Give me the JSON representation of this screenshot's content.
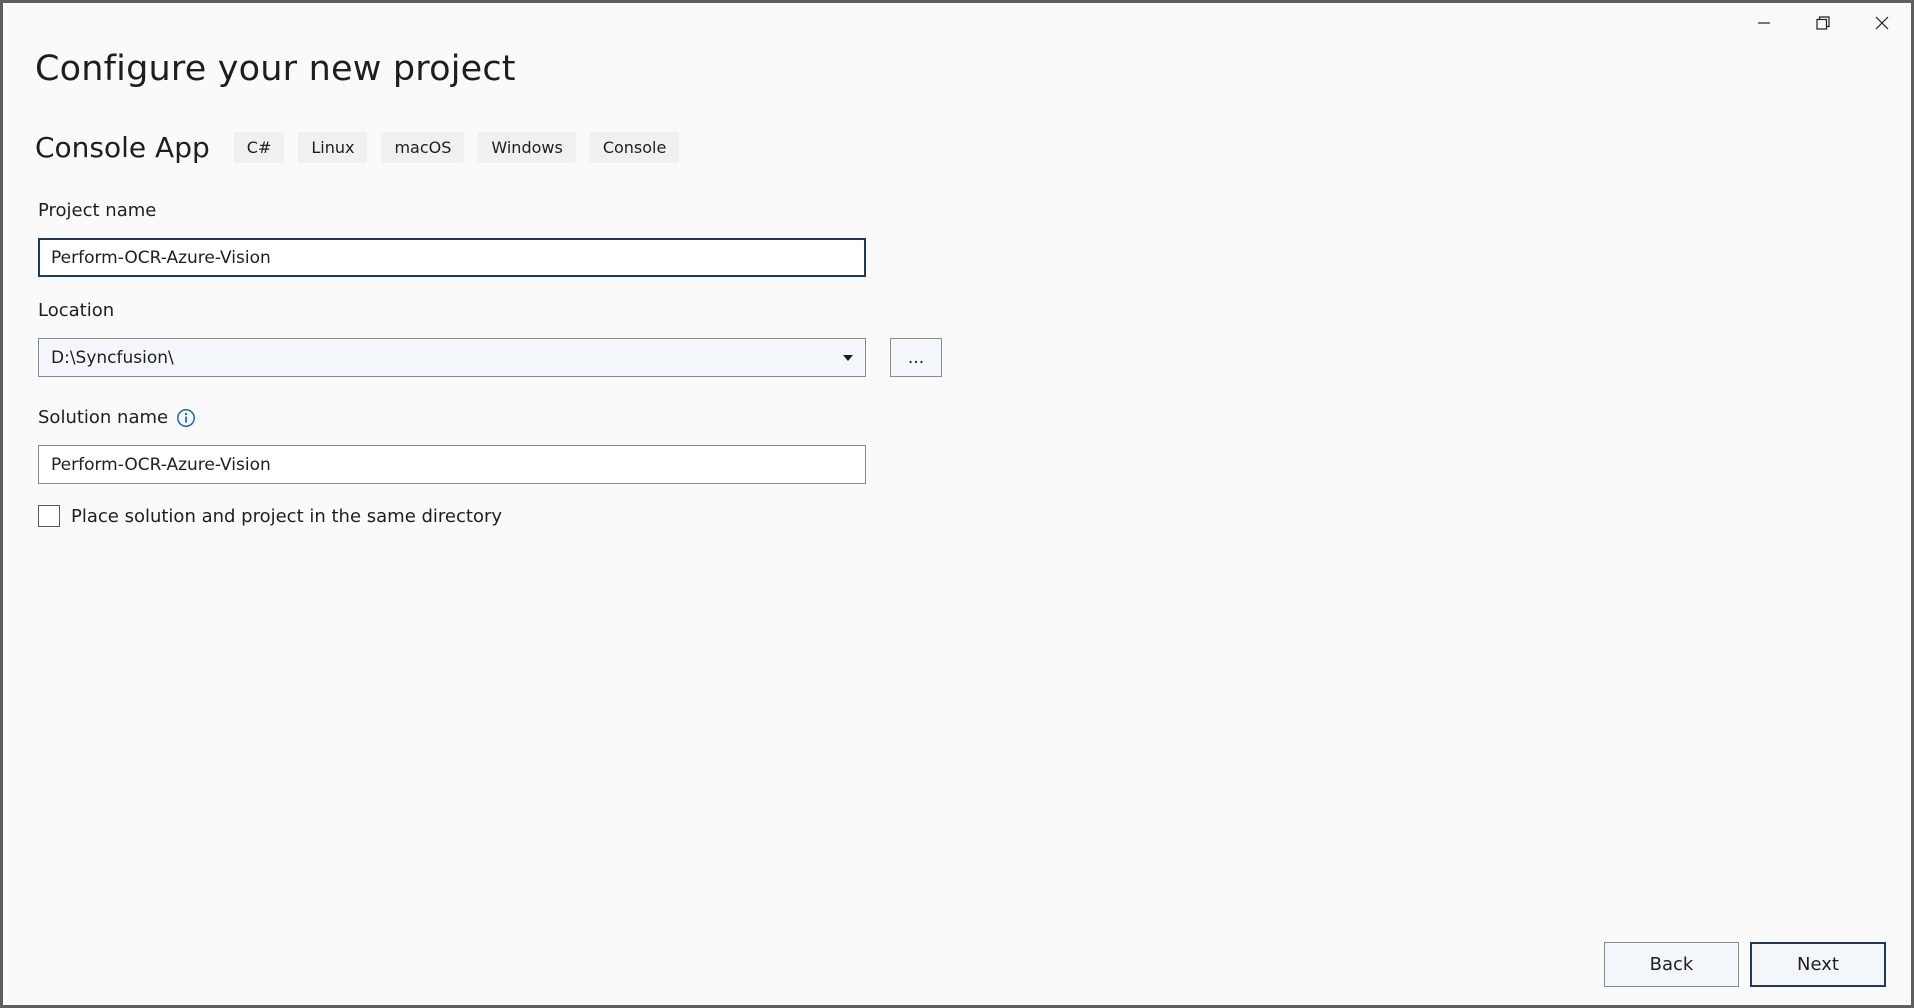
{
  "window": {
    "minimize_icon": "minimize-icon",
    "restore_icon": "restore-icon",
    "close_icon": "close-icon"
  },
  "page": {
    "title": "Configure your new project"
  },
  "template": {
    "name": "Console App",
    "tags": [
      "C#",
      "Linux",
      "macOS",
      "Windows",
      "Console"
    ]
  },
  "project_name": {
    "label": "Project name",
    "value": "Perform-OCR-Azure-Vision"
  },
  "location": {
    "label": "Location",
    "value": "D:\\Syncfusion\\",
    "browse_label": "..."
  },
  "solution_name": {
    "label": "Solution name",
    "value": "Perform-OCR-Azure-Vision",
    "info_icon": "info-icon"
  },
  "same_directory": {
    "label": "Place solution and project in the same directory",
    "checked": false
  },
  "footer": {
    "back_label": "Back",
    "next_label": "Next"
  },
  "colors": {
    "background": "#fafafa",
    "focus_border": "#1f3a5f",
    "info_accent": "#1a6bb5"
  }
}
